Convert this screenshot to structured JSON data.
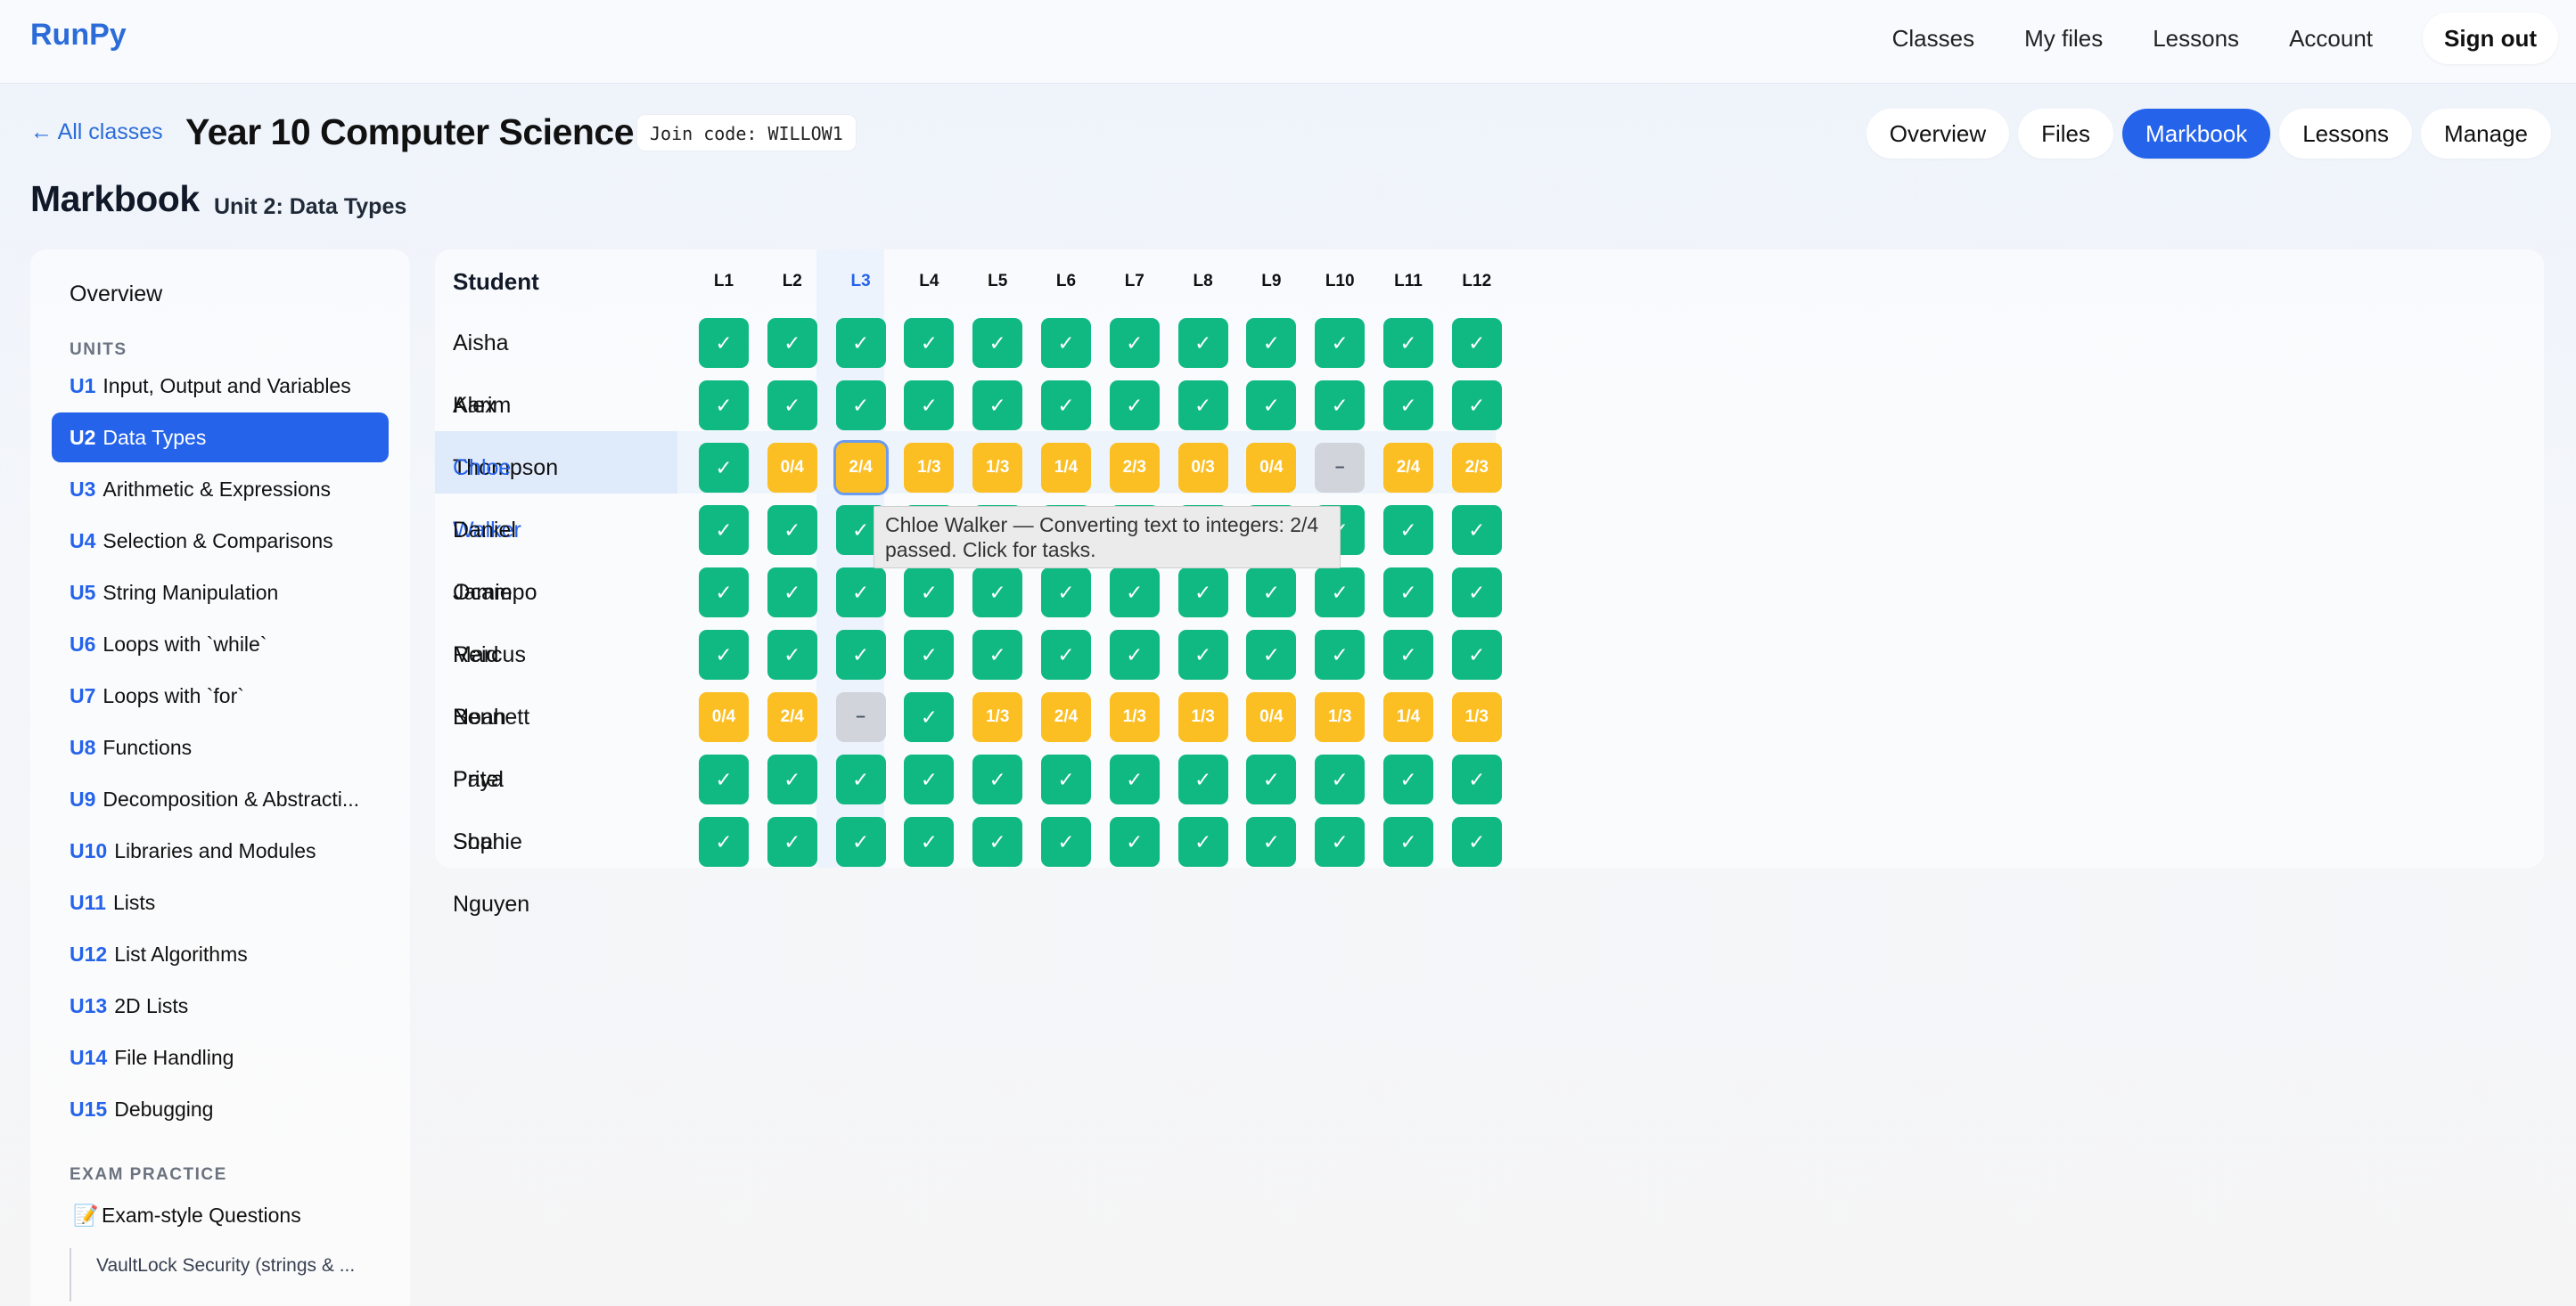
{
  "nav": {
    "brand": "RunPy",
    "links": [
      "Classes",
      "My files",
      "Lessons",
      "Account"
    ],
    "signout": "Sign out"
  },
  "header": {
    "back": "← All classes",
    "class_title": "Year 10 Computer Science",
    "join_code": "Join code: WILLOW1",
    "tabs": [
      "Overview",
      "Files",
      "Markbook",
      "Lessons",
      "Manage"
    ],
    "active_tab": "Markbook",
    "page_title": "Markbook",
    "unit_subtitle": "Unit 2: Data Types"
  },
  "sidebar": {
    "overview": "Overview",
    "units_heading": "UNITS",
    "units": [
      {
        "code": "U1",
        "label": "Input, Output and Variables"
      },
      {
        "code": "U2",
        "label": "Data Types"
      },
      {
        "code": "U3",
        "label": "Arithmetic & Expressions"
      },
      {
        "code": "U4",
        "label": "Selection & Comparisons"
      },
      {
        "code": "U5",
        "label": "String Manipulation"
      },
      {
        "code": "U6",
        "label": "Loops with `while`"
      },
      {
        "code": "U7",
        "label": "Loops with `for`"
      },
      {
        "code": "U8",
        "label": "Functions"
      },
      {
        "code": "U9",
        "label": "Decomposition & Abstracti..."
      },
      {
        "code": "U10",
        "label": "Libraries and Modules"
      },
      {
        "code": "U11",
        "label": "Lists"
      },
      {
        "code": "U12",
        "label": "List Algorithms"
      },
      {
        "code": "U13",
        "label": "2D Lists"
      },
      {
        "code": "U14",
        "label": "File Handling"
      },
      {
        "code": "U15",
        "label": "Debugging"
      }
    ],
    "active_unit": "U2",
    "exam_heading": "EXAM PRACTICE",
    "exam_icon": "memo-icon",
    "exam_icon_glyph": "📝",
    "exam_item": "Exam-style Questions",
    "exam_sub": "VaultLock Security (strings & ..."
  },
  "markbook": {
    "student_header": "Student",
    "columns": [
      "L1",
      "L2",
      "L3",
      "L4",
      "L5",
      "L6",
      "L7",
      "L8",
      "L9",
      "L10",
      "L11",
      "L12"
    ],
    "highlight_column": "L3",
    "selected_student": "Chloe Walker",
    "rows": [
      {
        "name": "Aisha Karim",
        "cells": [
          "✓",
          "✓",
          "✓",
          "✓",
          "✓",
          "✓",
          "✓",
          "✓",
          "✓",
          "✓",
          "✓",
          "✓"
        ]
      },
      {
        "name": "Alex Thompson",
        "cells": [
          "✓",
          "✓",
          "✓",
          "✓",
          "✓",
          "✓",
          "✓",
          "✓",
          "✓",
          "✓",
          "✓",
          "✓"
        ]
      },
      {
        "name": "Chloe Walker",
        "cells": [
          "✓",
          "0/4",
          "2/4",
          "1/3",
          "1/3",
          "1/4",
          "2/3",
          "0/3",
          "0/4",
          "–",
          "2/4",
          "2/3"
        ]
      },
      {
        "name": "Daniel Ocampo",
        "cells": [
          "✓",
          "✓",
          "✓",
          "✓",
          "✓",
          "✓",
          "✓",
          "✓",
          "✓",
          "✓",
          "✓",
          "✓"
        ]
      },
      {
        "name": "Jamie Reid",
        "cells": [
          "✓",
          "✓",
          "✓",
          "✓",
          "✓",
          "✓",
          "✓",
          "✓",
          "✓",
          "✓",
          "✓",
          "✓"
        ]
      },
      {
        "name": "Marcus Bennett",
        "cells": [
          "✓",
          "✓",
          "✓",
          "✓",
          "✓",
          "✓",
          "✓",
          "✓",
          "✓",
          "✓",
          "✓",
          "✓"
        ]
      },
      {
        "name": "Noah Patel",
        "cells": [
          "0/4",
          "2/4",
          "–",
          "✓",
          "1/3",
          "2/4",
          "1/3",
          "1/3",
          "0/4",
          "1/3",
          "1/4",
          "1/3"
        ]
      },
      {
        "name": "Priya Shah",
        "cells": [
          "✓",
          "✓",
          "✓",
          "✓",
          "✓",
          "✓",
          "✓",
          "✓",
          "✓",
          "✓",
          "✓",
          "✓"
        ]
      },
      {
        "name": "Sophie Nguyen",
        "cells": [
          "✓",
          "✓",
          "✓",
          "✓",
          "✓",
          "✓",
          "✓",
          "✓",
          "✓",
          "✓",
          "✓",
          "✓"
        ]
      }
    ],
    "tooltip": "Chloe Walker — Converting text to integers: 2/4 passed. Click for tasks."
  },
  "colors": {
    "accent": "#2563eb",
    "pass": "#10b981",
    "partial": "#fbbf24",
    "none": "#d1d5db"
  }
}
